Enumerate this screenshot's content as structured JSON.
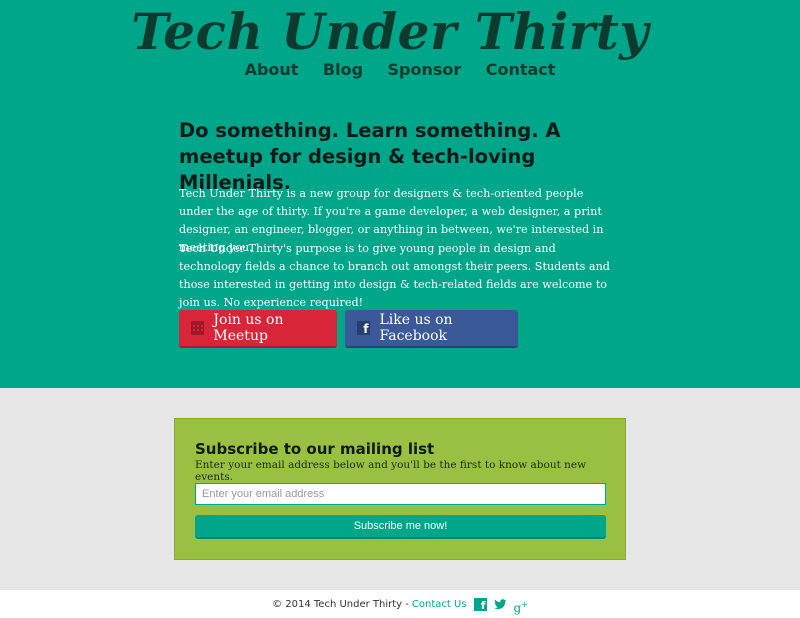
{
  "site": {
    "logo_text": "Tech Under Thirty",
    "nav": [
      "About",
      "Blog",
      "Sponsor",
      "Contact"
    ]
  },
  "hero": {
    "headline": "Do something. Learn something. A meetup for design & tech-loving Millenials.",
    "paragraph1": "Tech Under Thirty is a new group for designers & tech-oriented people under the age of thirty. If you're a game developer, a web designer, a print designer, an engineer, blogger, or anything in between, we're interested in meeting you.",
    "paragraph2": "Tech Under Thirty's purpose is to give young people in design and technology fields a chance to branch out amongst their peers. Students and those interested in getting into design & tech-related fields are welcome to join us. No experience required!",
    "buttons": {
      "meetup": "Join us on Meetup",
      "facebook": "Like us on Facebook"
    },
    "icons": {
      "meetup": "calendar-icon",
      "facebook": "facebook-icon"
    }
  },
  "subscribe": {
    "title": "Subscribe to our mailing list",
    "description": "Enter your email address below and you'll be the first to know about new events.",
    "email_placeholder": "Enter your email address",
    "email_value": "",
    "button": "Subscribe me now!"
  },
  "footer": {
    "copyright": "© 2014 Tech Under Thirty -",
    "contact_link": "Contact Us",
    "social_icons": [
      "facebook-icon",
      "twitter-icon",
      "google-plus-icon"
    ]
  },
  "colors": {
    "hero_bg": "#00a68a",
    "meetup_red": "#d9253a",
    "facebook_blue": "#3b5998",
    "subscribe_green": "#9ac042",
    "page_bg": "#e6e6e6"
  }
}
